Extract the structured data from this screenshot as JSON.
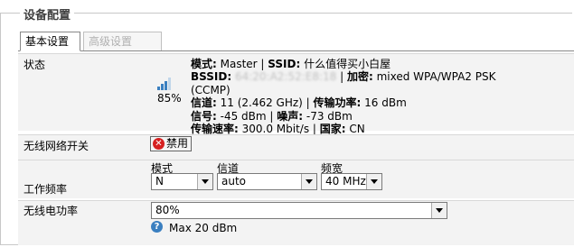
{
  "section": {
    "title": "设备配置"
  },
  "tabs": [
    {
      "label": "基本设置",
      "active": true
    },
    {
      "label": "高级设置",
      "active": false
    }
  ],
  "status": {
    "label": "状态",
    "signal_percent": "85%",
    "mode_label": "模式:",
    "mode_value": " Master | ",
    "ssid_label": "SSID:",
    "ssid_value": " 什么值得买小白屋",
    "bssid_label": "BSSID:",
    "bssid_value": " 64:20:A2:52:E8:18",
    "enc_sep": " | ",
    "enc_label": "加密:",
    "enc_value": " mixed WPA/WPA2 PSK",
    "enc_value2": "(CCMP)",
    "channel_label": "信道:",
    "channel_value": " 11 (2.462 GHz) | ",
    "txpower_label": "传输功率:",
    "txpower_value": " 16 dBm",
    "signal_label": "信号:",
    "signal_value": " -45 dBm | ",
    "noise_label": "噪声:",
    "noise_value": " -73 dBm",
    "rate_label": "传输速率:",
    "rate_value": " 300.0 Mbit/s | ",
    "country_label": "国家:",
    "country_value": " CN"
  },
  "wifi_switch": {
    "label": "无线网络开关",
    "button_label": "禁用",
    "icon": "disable-icon"
  },
  "frequency": {
    "label": "工作频率",
    "mode": {
      "label": "模式",
      "value": "N"
    },
    "channel": {
      "label": "信道",
      "value": "auto"
    },
    "width": {
      "label": "频宽",
      "value": "40 MHz"
    }
  },
  "power": {
    "label": "无线电功率",
    "value": "80%",
    "hint": "Max 20 dBm",
    "icon": "help-icon"
  },
  "colors": {
    "signal_bar": "#3a7fc0",
    "disable_icon": "#d62020",
    "help_icon": "#3a7fc0"
  }
}
